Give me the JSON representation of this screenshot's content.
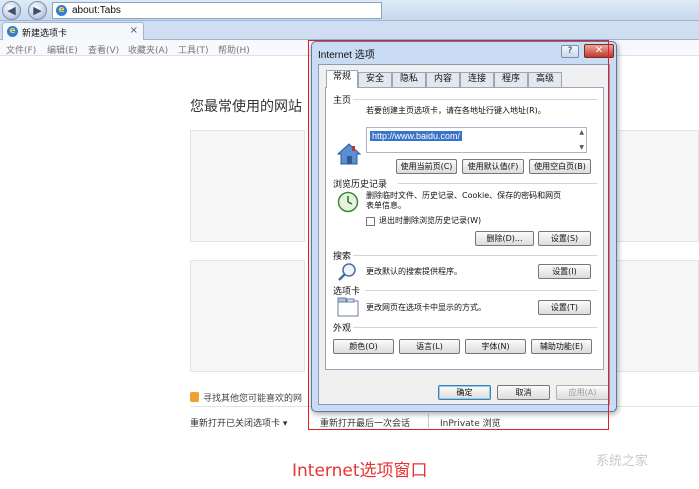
{
  "browser": {
    "address": "about:Tabs",
    "tab_label": "新建选项卡",
    "tab_close": "×",
    "menu": [
      "文件(F)",
      "编辑(E)",
      "查看(V)",
      "收藏夹(A)",
      "工具(T)",
      "帮助(H)"
    ]
  },
  "page": {
    "heading": "您最常使用的网站",
    "find_sites": "寻找其他您可能喜欢的网",
    "reopen_closed_tabs": "重新打开已关闭选项卡 ▾",
    "reopen_last_session": "重新打开最后一次会话",
    "inprivate": "InPrivate 浏览"
  },
  "dialog": {
    "title": "Internet 选项",
    "help": "?",
    "close": "✕",
    "tabs": [
      "常规",
      "安全",
      "隐私",
      "内容",
      "连接",
      "程序",
      "高级"
    ],
    "active_tab": "常规",
    "homepage": {
      "title": "主页",
      "description": "若要创建主页选项卡，请在各地址行键入地址(R)。",
      "url": "http://www.baidu.com/",
      "buttons": [
        "使用当前页(C)",
        "使用默认值(F)",
        "使用空白页(B)"
      ]
    },
    "history": {
      "title": "浏览历史记录",
      "description_line1": "删除临时文件、历史记录、Cookie、保存的密码和网页",
      "description_line2": "表单信息。",
      "checkbox_label": "退出时删除浏览历史记录(W)",
      "checkbox_checked": false,
      "delete_button": "删除(D)...",
      "settings_button": "设置(S)"
    },
    "search": {
      "title": "搜索",
      "description": "更改默认的搜索提供程序。",
      "settings_button": "设置(I)"
    },
    "tabs_section": {
      "title": "选项卡",
      "description": "更改网页在选项卡中显示的方式。",
      "settings_button": "设置(T)"
    },
    "appearance": {
      "title": "外观",
      "buttons": [
        "颜色(O)",
        "语言(L)",
        "字体(N)",
        "辅助功能(E)"
      ]
    },
    "footer": {
      "ok": "确定",
      "cancel": "取消",
      "apply": "应用(A)"
    }
  },
  "annotation": {
    "caption": "Internet选项窗口",
    "watermark": "系统之家",
    "highlight_color": "#e02020"
  },
  "colors": {
    "chrome_blue": "#c6d8ee",
    "dialog_frame": "#c9dcf3",
    "caption_red": "#e63333"
  }
}
